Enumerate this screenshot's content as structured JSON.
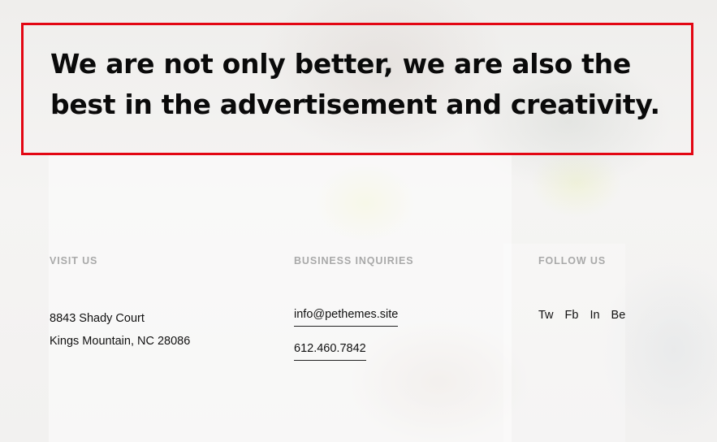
{
  "hero": {
    "heading": "We are not only better, we are also the best in the advertisement and creativity."
  },
  "visit": {
    "heading": "VISIT US",
    "address_line1": "8843 Shady Court",
    "address_line2": "Kings Mountain, NC 28086"
  },
  "business": {
    "heading": "BUSINESS INQUIRIES",
    "email": "info@pethemes.site",
    "phone": "612.460.7842"
  },
  "follow": {
    "heading": "FOLLOW US",
    "links": [
      "Tw",
      "Fb",
      "In",
      "Be"
    ]
  },
  "colors": {
    "highlight_border": "#e30613",
    "heading_muted": "#a9a9a9",
    "text": "#111111"
  }
}
